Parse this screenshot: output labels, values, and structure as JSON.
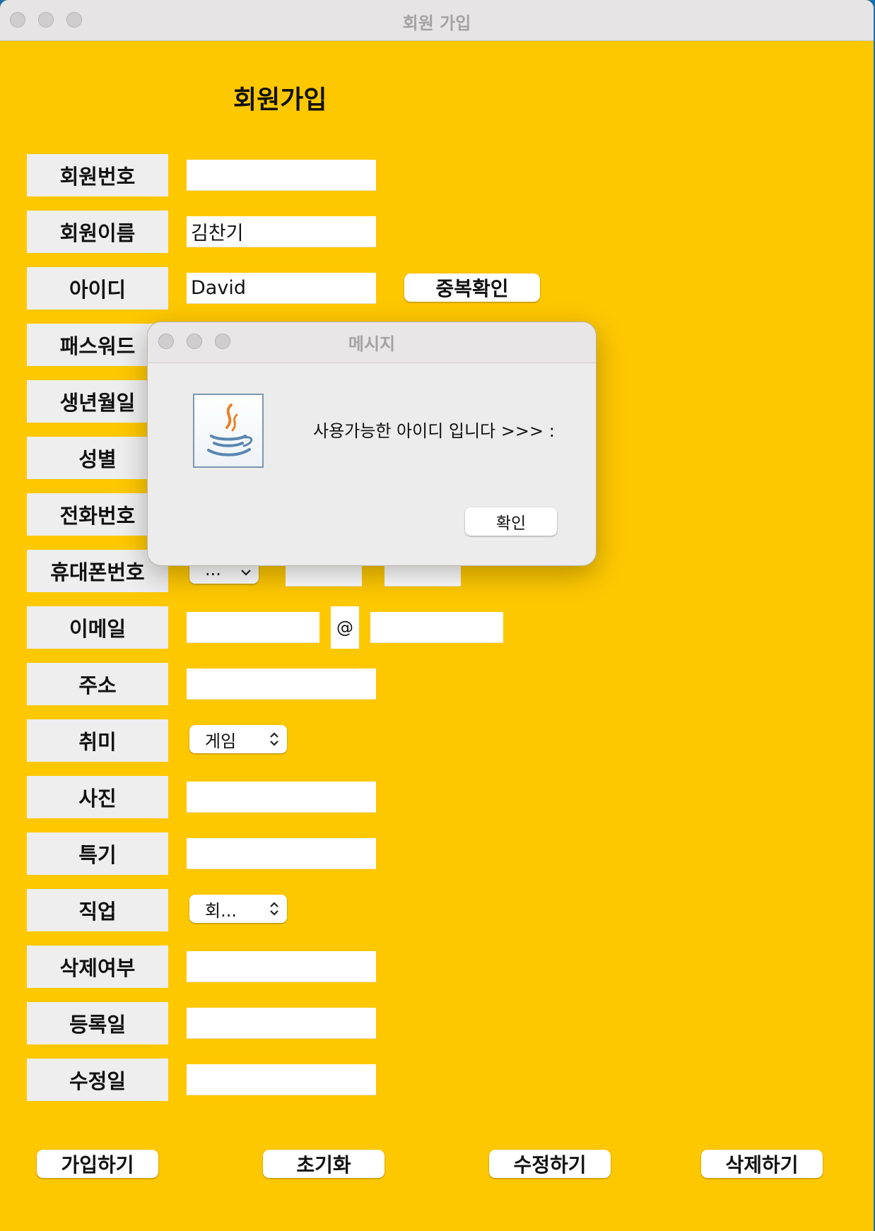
{
  "window": {
    "title": "회원 가입"
  },
  "form": {
    "heading": "회원가입",
    "labels": {
      "member_no": "회원번호",
      "member_name": "회원이름",
      "user_id": "아이디",
      "password": "패스워드",
      "birthdate": "생년월일",
      "gender": "성별",
      "phone": "전화번호",
      "mobile": "휴대폰번호",
      "email": "이메일",
      "address": "주소",
      "hobby": "취미",
      "photo": "사진",
      "talent": "특기",
      "job": "직업",
      "deleted": "삭제여부",
      "reg_date": "등록일",
      "mod_date": "수정일"
    },
    "values": {
      "member_no": "",
      "member_name": "김찬기",
      "user_id": "David",
      "mobile_prefix": "...",
      "email_at": "@",
      "hobby": "게임",
      "job": "회..."
    },
    "dup_check_button": "중복확인"
  },
  "buttons": {
    "join": "가입하기",
    "reset": "초기화",
    "edit": "수정하기",
    "delete": "삭제하기"
  },
  "dialog": {
    "title": "메시지",
    "message": "사용가능한 아이디 입니다 >>> :",
    "ok": "확인",
    "icon": "java-icon"
  },
  "colors": {
    "background": "#fec800",
    "label_bg": "#eeeeee"
  }
}
